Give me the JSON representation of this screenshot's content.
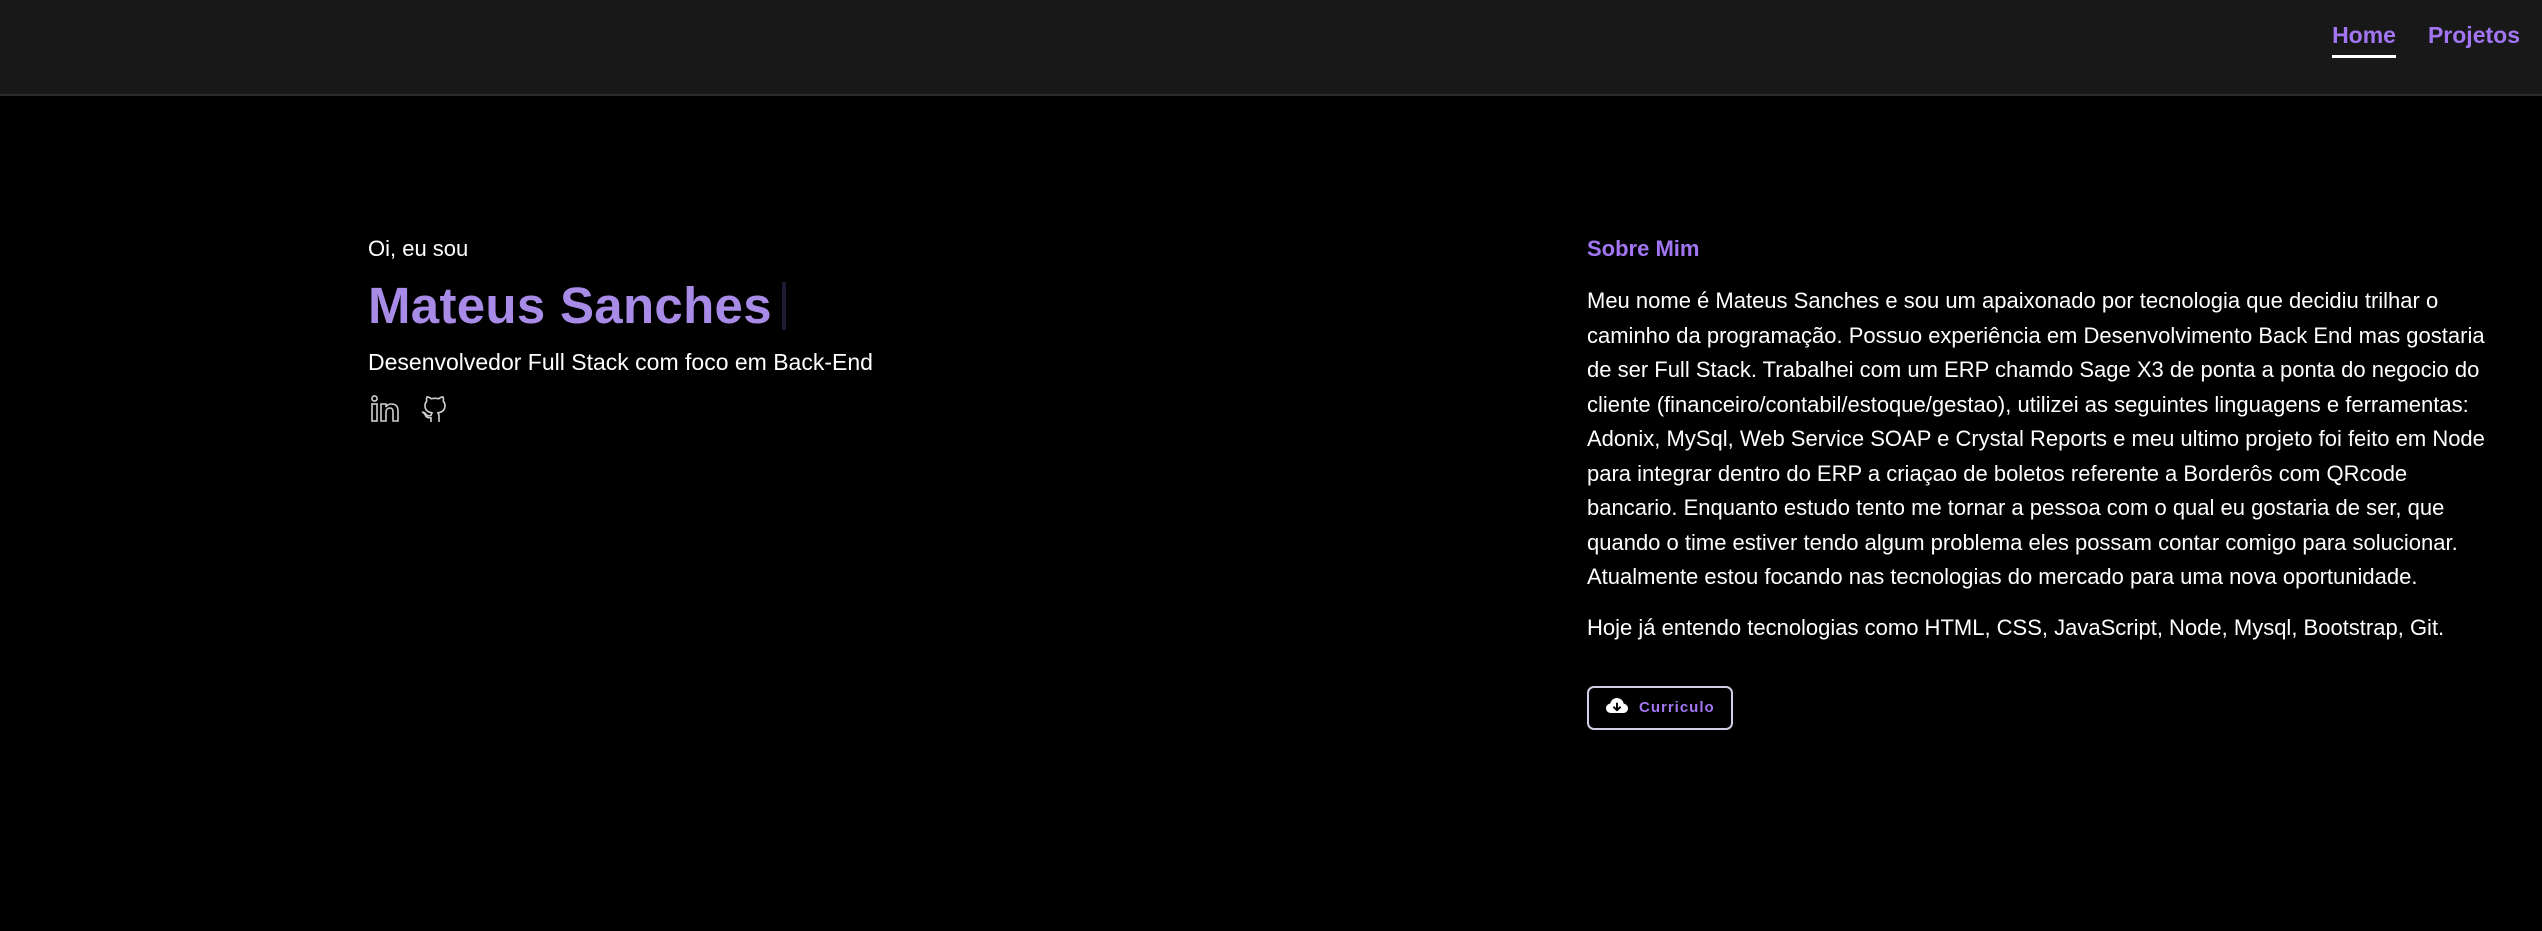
{
  "nav": {
    "items": [
      {
        "label": "Home",
        "active": true
      },
      {
        "label": "Projetos",
        "active": false
      }
    ]
  },
  "hero": {
    "greeting": "Oi, eu sou",
    "name": "Mateus Sanches",
    "role": "Desenvolvedor Full Stack com foco em Back-End",
    "socials": [
      {
        "icon": "linkedin-icon"
      },
      {
        "icon": "github-icon"
      }
    ]
  },
  "about": {
    "title": "Sobre Mim",
    "text": "Meu nome é Mateus Sanches e sou um apaixonado por tecnologia que decidiu trilhar o caminho da programação. Possuo experiência em Desenvolvimento Back End mas gostaria de ser Full Stack. Trabalhei com um ERP chamdo Sage X3 de ponta a ponta do negocio do cliente (financeiro/contabil/estoque/gestao), utilizei as seguintes linguagens e ferramentas: Adonix, MySql, Web Service SOAP e Crystal Reports e meu ultimo projeto foi feito em Node para integrar dentro do ERP a criaçao de boletos referente a Borderôs com QRcode bancario. Enquanto estudo tento me tornar a pessoa com o qual eu gostaria de ser, que quando o time estiver tendo algum problema eles possam contar comigo para solucionar. Atualmente estou focando nas tecnologias do mercado para uma nova oportunidade.",
    "techs": "Hoje já entendo tecnologias como HTML, CSS, JavaScript, Node, Mysql, Bootstrap, Git.",
    "cv_button": {
      "label": "Curriculo",
      "icon": "cloud-download-icon"
    }
  },
  "colors": {
    "accent": "#a276f2",
    "name": "#a88be6",
    "navbar_bg": "#181818",
    "page_bg": "#000000"
  }
}
